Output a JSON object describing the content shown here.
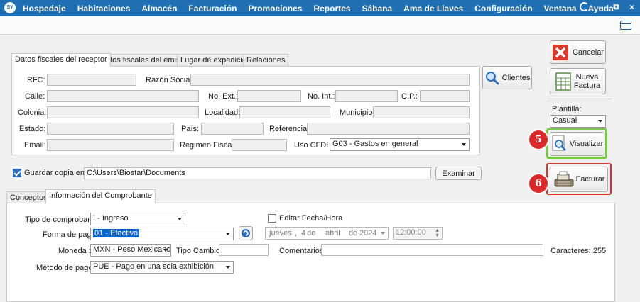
{
  "menubar": {
    "logo": "SY",
    "items": [
      "Hospedaje",
      "Habitaciones",
      "Almacén",
      "Facturación",
      "Promociones",
      "Reportes",
      "Sábana",
      "Ama de Llaves",
      "Configuración",
      "Ventana",
      "Ayuda"
    ],
    "window_buttons": {
      "minimize": "–",
      "restore": "⧉",
      "close": "×"
    }
  },
  "receptor_tabs": [
    "Datos fiscales del receptor",
    "Datos fiscales del emisor",
    "Lugar de expedición",
    "Relaciones"
  ],
  "receptor": {
    "rfc_label": "RFC:",
    "rfc_value": "",
    "razon_label": "Razón Social:",
    "razon_value": "",
    "calle_label": "Calle:",
    "calle_value": "",
    "noext_label": "No. Ext.:",
    "noext_value": "",
    "noint_label": "No. Int.:",
    "noint_value": "",
    "cp_label": "C.P.:",
    "cp_value": "",
    "colonia_label": "Colonia:",
    "colonia_value": "",
    "localidad_label": "Localidad:",
    "localidad_value": "",
    "municipio_label": "Municipio:",
    "municipio_value": "",
    "estado_label": "Estado:",
    "estado_value": "",
    "pais_label": "País:",
    "pais_value": "",
    "referencia_label": "Referencia:",
    "referencia_value": "",
    "email_label": "Email:",
    "email_value": "",
    "regimen_label": "Regimen Fiscal:",
    "regimen_value": "",
    "usocfdi_label": "Uso CFDI :",
    "usocfdi_value": "G03 - Gastos en general"
  },
  "clientes_button": "Clientes",
  "guardar": {
    "label": "Guardar copia en:",
    "checked": true,
    "path": "C:\\Users\\Biostar\\Documents",
    "examinar": "Examinar"
  },
  "lower_tabs": [
    "Conceptos",
    "Información del Comprobante"
  ],
  "comprobante": {
    "tipo_label": "Tipo de comprobante:",
    "tipo_value": "I - Ingreso",
    "forma_label": "Forma de pago:",
    "forma_value": "01 - Efectivo",
    "editar_label": "Editar Fecha/Hora",
    "editar_checked": false,
    "fecha": {
      "weekday": "jueves",
      "sep1": ",",
      "day": "4",
      "de1": "de",
      "month": "abril",
      "de2": "de",
      "year": "2024"
    },
    "hora": "12:00:00",
    "moneda_label": "Moneda :",
    "moneda_value": "MXN - Peso Mexicano",
    "tipocambio_label": "Tipo Cambio:",
    "tipocambio_value": "",
    "comentarios_label": "Comentarios:",
    "comentarios_value": "",
    "caracteres_label": "Caracteres: 255",
    "metodo_label": "Método de pago:",
    "metodo_value": "PUE - Pago en una sola exhibición"
  },
  "side": {
    "cancelar": "Cancelar",
    "nueva_line1": "Nueva",
    "nueva_line2": "Factura",
    "plantilla_label": "Plantilla:",
    "plantilla_value": "Casual",
    "visualizar": "Visualizar",
    "facturar": "Facturar",
    "badge5": "5",
    "badge6": "6"
  },
  "colors": {
    "menubar": "#1f6fb2",
    "selection": "#0a64c8",
    "highlight_green": "#7ac943",
    "highlight_red": "#e0312b",
    "badge": "#d92b2b"
  }
}
